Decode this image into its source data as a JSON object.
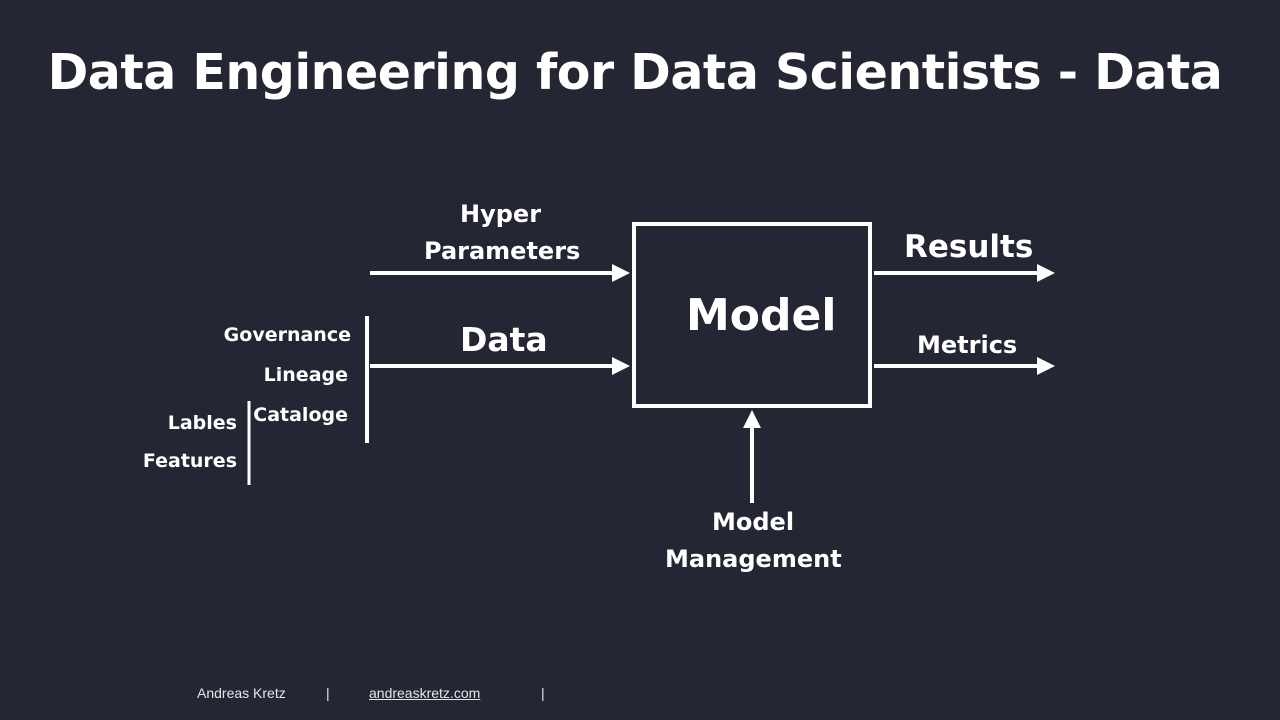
{
  "slide": {
    "title": "Data Engineering for Data Scientists - Data",
    "background_color": "#242733",
    "foreground_color": "#ffffff"
  },
  "diagram": {
    "center_box": {
      "label": "Model"
    },
    "inputs": [
      {
        "id": "hyper",
        "label_line1": "Hyper",
        "label_line2": "Parameters"
      },
      {
        "id": "data",
        "label": "Data"
      },
      {
        "id": "model-management",
        "label_line1": "Model",
        "label_line2": "Management"
      }
    ],
    "outputs": [
      {
        "id": "results",
        "label": "Results"
      },
      {
        "id": "metrics",
        "label": "Metrics"
      }
    ],
    "data_aspects": [
      "Governance",
      "Lineage",
      "Cataloge"
    ],
    "data_subaspects": [
      "Lables",
      "Features"
    ]
  },
  "footer": {
    "author": "Andreas Kretz",
    "separator": "|",
    "link": "andreaskretz.com"
  }
}
